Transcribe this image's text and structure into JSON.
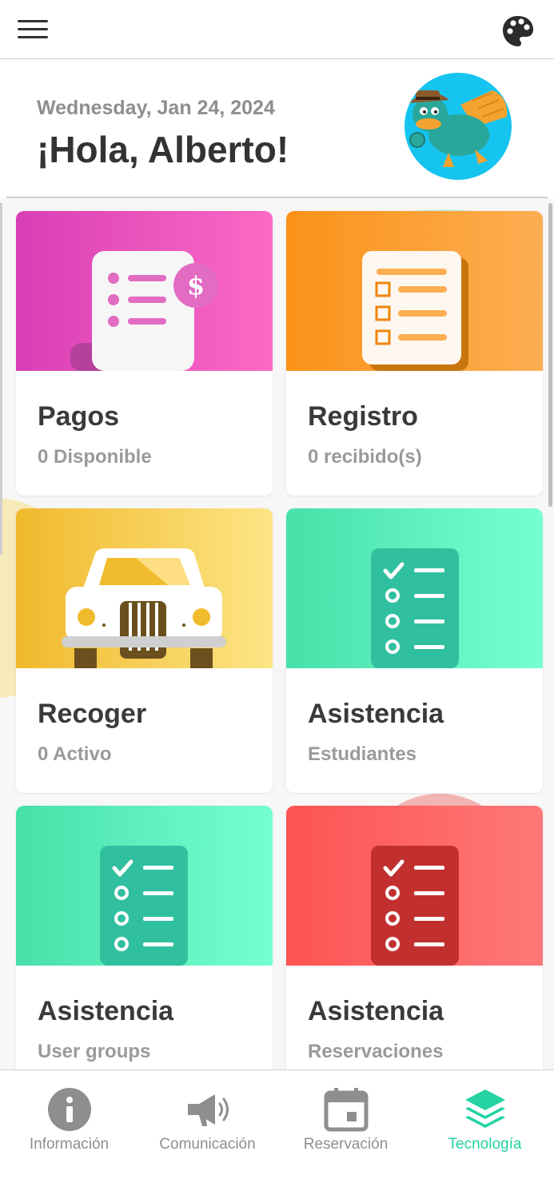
{
  "topbar": {
    "menu_icon": "hamburger-menu-icon",
    "palette_icon": "palette-icon"
  },
  "header": {
    "date": "Wednesday, Jan 24, 2024",
    "greeting": "¡Hola, Alberto!",
    "avatar": "avatar"
  },
  "cards": [
    {
      "title": "Pagos",
      "subtitle": "0 Disponible",
      "icon": "invoice-icon",
      "color": "#fb69c4"
    },
    {
      "title": "Registro",
      "subtitle": "0 recibido(s)",
      "icon": "checklist-document-icon",
      "color": "#fdae52"
    },
    {
      "title": "Recoger",
      "subtitle": "0 Activo",
      "icon": "car-icon",
      "color": "#fde585"
    },
    {
      "title": "Asistencia",
      "subtitle": "Estudiantes",
      "icon": "attendance-list-icon",
      "color": "#76ffd2"
    },
    {
      "title": "Asistencia",
      "subtitle": "User groups",
      "icon": "attendance-list-icon",
      "color": "#76ffd2"
    },
    {
      "title": "Asistencia",
      "subtitle": "Reservaciones",
      "icon": "attendance-list-icon",
      "color": "#fe7878"
    }
  ],
  "nav": {
    "items": [
      {
        "label": "Información",
        "icon": "info-icon"
      },
      {
        "label": "Comunicación",
        "icon": "megaphone-icon"
      },
      {
        "label": "Reservación",
        "icon": "calendar-icon"
      },
      {
        "label": "Tecnología",
        "icon": "layers-icon",
        "active": true
      }
    ],
    "active_color": "#25d3a3",
    "inactive_color": "#8e8e8e"
  }
}
